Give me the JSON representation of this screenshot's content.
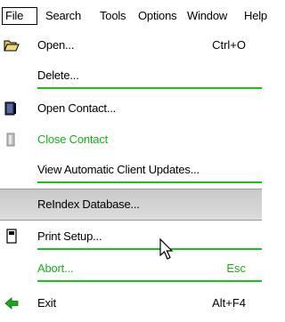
{
  "menubar": {
    "file": "File",
    "search": "Search",
    "tools": "Tools",
    "options": "Options",
    "window": "Window",
    "help": "Help"
  },
  "menu": {
    "open": {
      "label": "Open...",
      "shortcut": "Ctrl+O"
    },
    "delete": {
      "label": "Delete..."
    },
    "open_contact": {
      "label": "Open Contact..."
    },
    "close_contact": {
      "label": "Close Contact"
    },
    "view_updates": {
      "label": "View Automatic Client Updates..."
    },
    "reindex": {
      "label": "ReIndex Database..."
    },
    "print_setup": {
      "label": "Print Setup..."
    },
    "abort": {
      "label": "Abort...",
      "shortcut": "Esc"
    },
    "exit": {
      "label": "Exit",
      "shortcut": "Alt+F4"
    }
  },
  "colors": {
    "green": "#17b417",
    "highlight": "#cfcfcf"
  }
}
